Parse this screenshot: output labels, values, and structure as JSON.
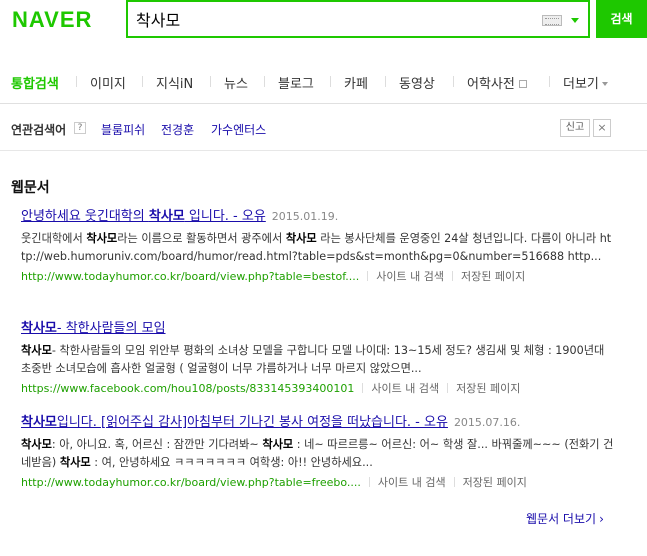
{
  "header": {
    "logo": "NAVER",
    "search_value": "착사모",
    "search_button": "검색"
  },
  "tabs": [
    {
      "label": "통합검색",
      "active": true
    },
    {
      "label": "이미지"
    },
    {
      "label": "지식iN"
    },
    {
      "label": "뉴스"
    },
    {
      "label": "블로그"
    },
    {
      "label": "카페"
    },
    {
      "label": "동영상"
    },
    {
      "label": "어학사전"
    },
    {
      "label": "더보기"
    }
  ],
  "related": {
    "label": "연관검색어",
    "help": "?",
    "items": [
      "블룸피쉬",
      "전경훈",
      "가수엔터스"
    ],
    "report": "신고",
    "close": "×"
  },
  "section": {
    "title": "웹문서",
    "more": "웹문서 더보기",
    "more_chevron": "›"
  },
  "results": [
    {
      "title_pre": "안녕하세요 웃긴대학의 ",
      "title_bold": "착사모",
      "title_post": " 입니다. - 오유",
      "date": "2015.01.19.",
      "desc_segments": [
        {
          "t": "웃긴대학에서 "
        },
        {
          "t": "착사모",
          "b": true
        },
        {
          "t": "라는 이름으로 활동하면서 광주에서 "
        },
        {
          "t": "착사모",
          "b": true
        },
        {
          "t": " 라는 봉사단체를 운영중인 24살 청년입니다. 다름이 아니라 http://web.humoruniv.com/board/humor/read.html?table=pds&st=month&pg=0&number=516688 http..."
        }
      ],
      "url": "http://www.todayhumor.co.kr/board/view.php?table=bestof....",
      "action1": "사이트 내 검색",
      "action2": "저장된 페이지"
    },
    {
      "title_pre": "",
      "title_bold": "착사모",
      "title_post": "- 착한사람들의 모임",
      "date": "",
      "desc_segments": [
        {
          "t": "착사모",
          "b": true
        },
        {
          "t": "- 착한사람들의 모임 위안부 평화의 소녀상 모델을 구합니다 모델 나이대: 13~15세 정도? 생김새 및 체형 : 1900년대 초중반 소녀모습에 흡사한 얼굴형 ( 얼굴형이 너무 갸름하거나 너무 마르지 않았으면..."
        }
      ],
      "url": "https://www.facebook.com/hou108/posts/833145393400101",
      "action1": "사이트 내 검색",
      "action2": "저장된 페이지"
    },
    {
      "title_pre": "",
      "title_bold": "착사모",
      "title_post": "입니다. [읽어주십 감사]아침부터 기나긴 봉사 여정을 떠났습니다. - 오유",
      "date": "2015.07.16.",
      "desc_segments": [
        {
          "t": "착사모",
          "b": true
        },
        {
          "t": ": 아, 아니요. 혹, 어르신 : 잠깐만 기다려봐~ "
        },
        {
          "t": "착사모",
          "b": true
        },
        {
          "t": " : 네~ 따르르릉~ 어르신: 어~ 학생 잘... 바꿔줄께~~~ (전화기 건네받음) "
        },
        {
          "t": "착사모",
          "b": true
        },
        {
          "t": " : 여, 안녕하세요 ㅋㅋㅋㅋㅋㅋㅋ 여학생: 아!! 안녕하세요..."
        }
      ],
      "url": "http://www.todayhumor.co.kr/board/view.php?table=freebo....",
      "action1": "사이트 내 검색",
      "action2": "저장된 페이지"
    }
  ],
  "colors": {
    "brand": "#1ec800",
    "link": "#1a0dab",
    "url": "#1ea000"
  }
}
